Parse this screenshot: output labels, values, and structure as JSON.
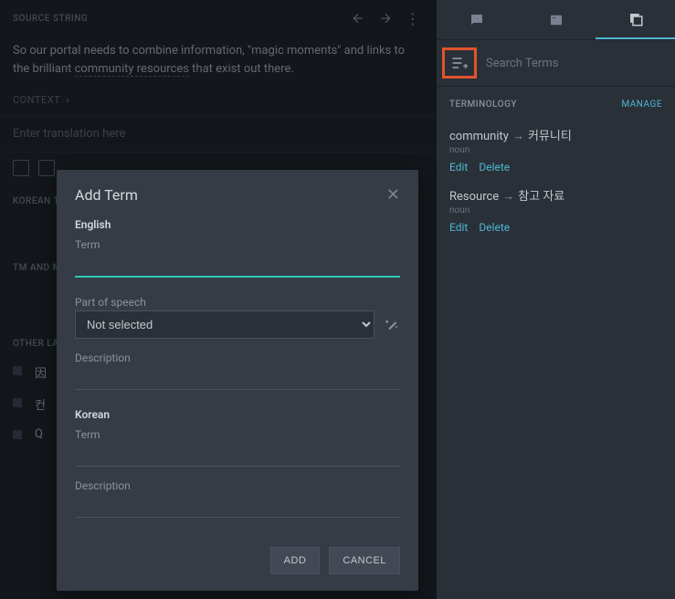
{
  "source": {
    "header_label": "SOURCE STRING",
    "text_pre": "So our portal needs to combine information, \"magic moments\" and links to the brilliant ",
    "text_underlined": "community resources",
    "text_post": " that exist out there.",
    "context_label": "CONTEXT"
  },
  "translation": {
    "placeholder": "Enter translation here"
  },
  "sections": {
    "korean": "KOREAN T",
    "tm": "TM AND M",
    "other": "OTHER LA"
  },
  "other_langs": {
    "items": [
      {
        "text": "因"
      },
      {
        "text": "컨"
      },
      {
        "text": "Q"
      }
    ]
  },
  "sidebar": {
    "search_placeholder": "Search Terms",
    "terminology_label": "TERMINOLOGY",
    "manage_label": "MANAGE",
    "terms": [
      {
        "source": "community",
        "target": "커뮤니티",
        "pos": "noun"
      },
      {
        "source": "Resource",
        "target": "참고 자료",
        "pos": "noun"
      }
    ],
    "edit_label": "Edit",
    "delete_label": "Delete"
  },
  "modal": {
    "title": "Add Term",
    "lang1_label": "English",
    "term_label": "Term",
    "pos_label": "Part of speech",
    "pos_value": "Not selected",
    "desc_label": "Description",
    "lang2_label": "Korean",
    "add_btn": "ADD",
    "cancel_btn": "CANCEL"
  }
}
